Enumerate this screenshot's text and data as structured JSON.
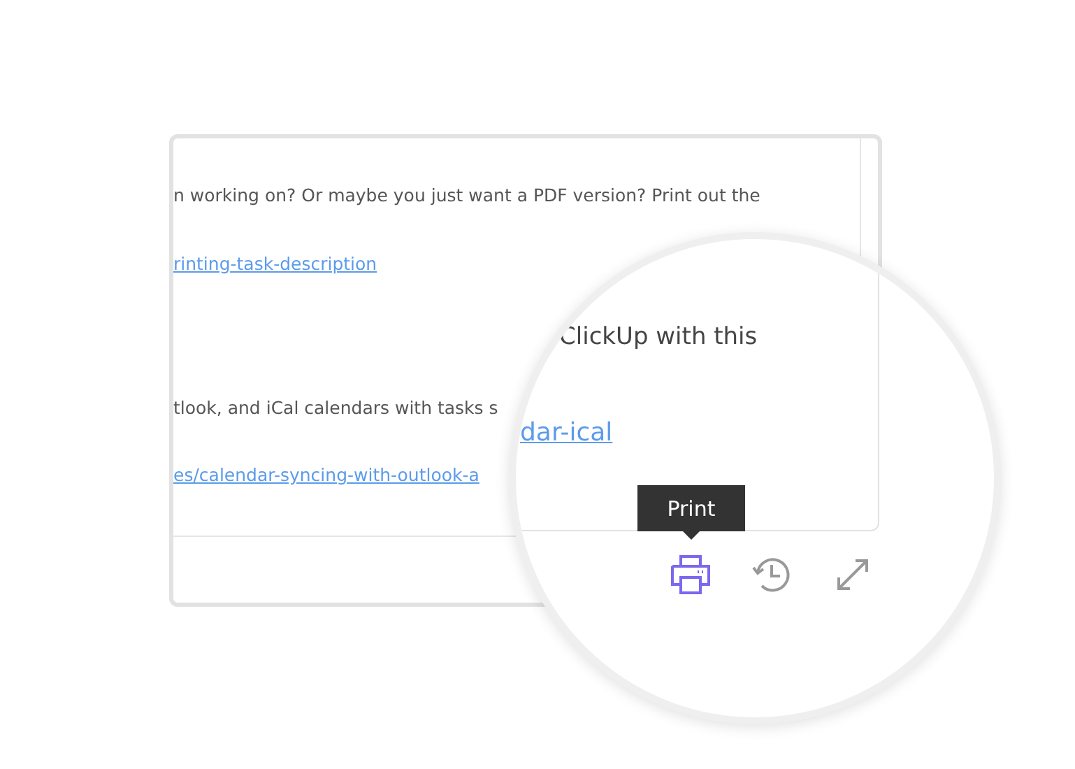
{
  "document": {
    "lines": [
      {
        "kind": "text",
        "text": "n working on? Or maybe you just want a PDF version? Print out the"
      },
      {
        "kind": "link",
        "text": "rinting-task-description"
      },
      {
        "kind": "text",
        "text": "tlook, and iCal calendars with tasks s"
      },
      {
        "kind": "link",
        "text": "es/calendar-syncing-with-outlook-a"
      }
    ]
  },
  "magnifier": {
    "heading": "ClickUp with this",
    "link": "dar-ical",
    "tooltip": "Print",
    "toolbar": [
      {
        "kind": "print",
        "hovered": true
      },
      {
        "kind": "history",
        "hovered": false
      },
      {
        "kind": "expand",
        "hovered": false
      }
    ]
  }
}
